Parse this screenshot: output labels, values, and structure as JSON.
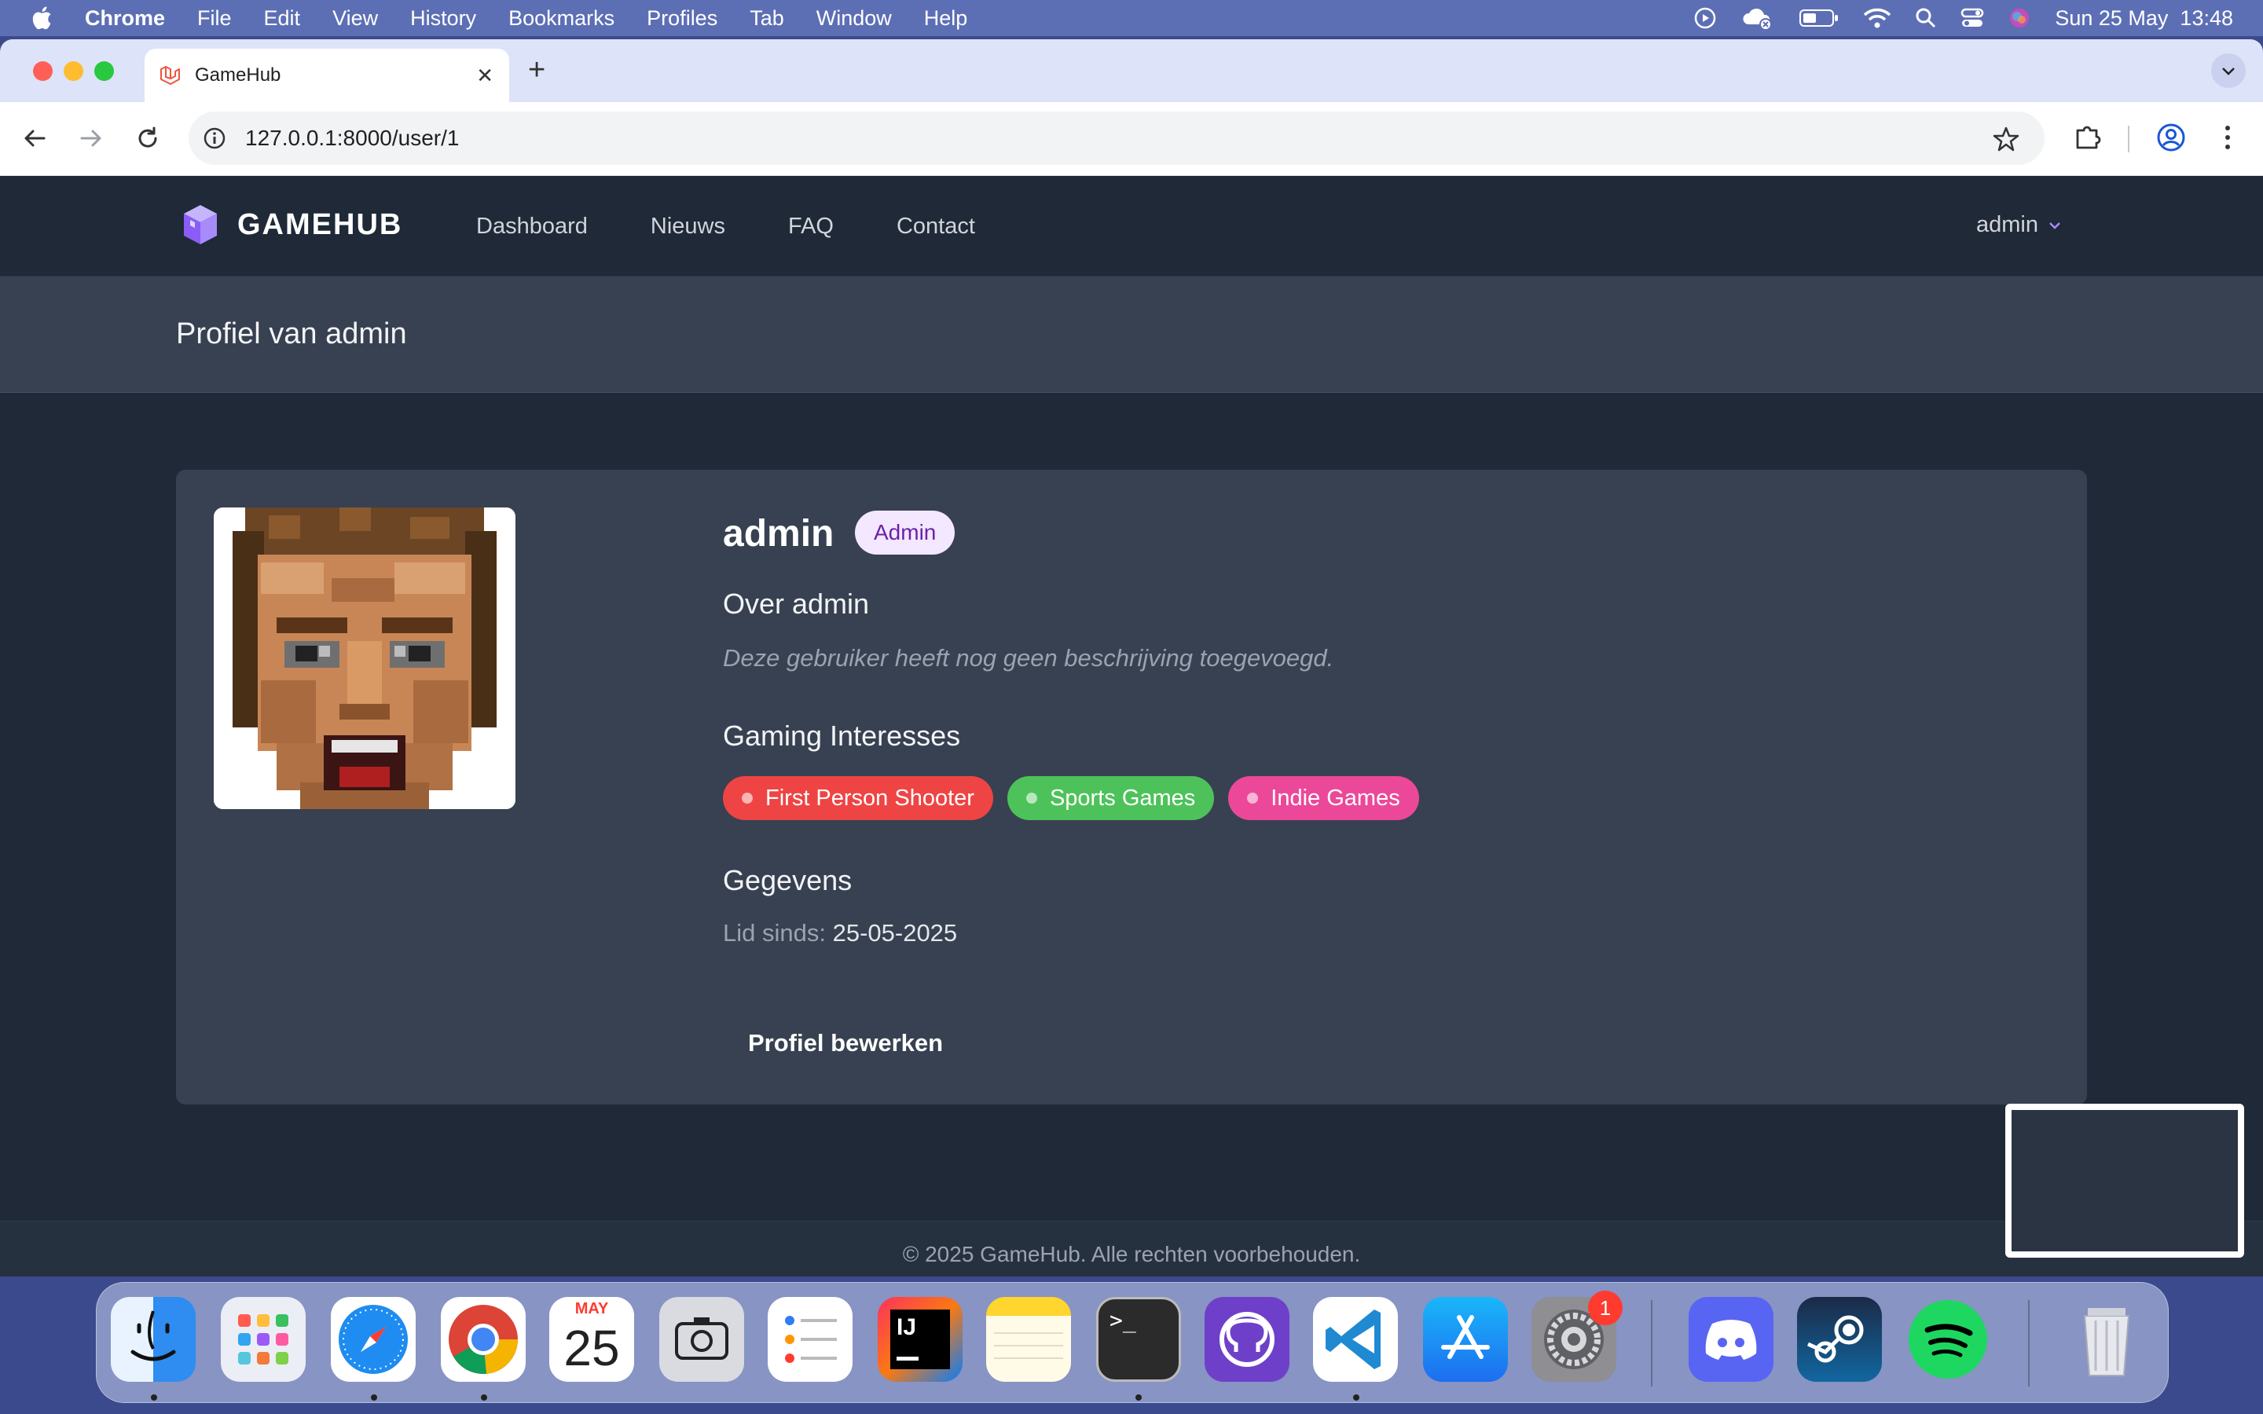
{
  "menubar": {
    "app_name": "Chrome",
    "items": [
      "File",
      "Edit",
      "View",
      "History",
      "Bookmarks",
      "Profiles",
      "Tab",
      "Window",
      "Help"
    ],
    "clock": "Sun 25 May  13:48"
  },
  "browser": {
    "tab_title": "GameHub",
    "url": "127.0.0.1:8000/user/1"
  },
  "site": {
    "brand": "GAMEHUB",
    "nav": [
      "Dashboard",
      "Nieuws",
      "FAQ",
      "Contact"
    ],
    "user_menu": "admin",
    "page_title": "Profiel van admin"
  },
  "profile": {
    "username": "admin",
    "role": "Admin",
    "about_title": "Over admin",
    "bio": "Deze gebruiker heeft nog geen beschrijving toegevoegd.",
    "interests_title": "Gaming Interesses",
    "interests": [
      {
        "label": "First Person Shooter",
        "color": "#ef4444"
      },
      {
        "label": "Sports Games",
        "color": "#4ec25a"
      },
      {
        "label": "Indie Games",
        "color": "#ec4899"
      }
    ],
    "details_title": "Gegevens",
    "member_since_label": "Lid sinds:",
    "member_since": "25-05-2025",
    "edit_button": "Profiel bewerken"
  },
  "footer": {
    "copyright": "© 2025 GameHub. Alle rechten voorbehouden."
  },
  "dock": {
    "calendar_month": "MAY",
    "calendar_day": "25",
    "settings_badge": "1"
  },
  "colors": {
    "page_bg": "#1f2937",
    "card_bg": "#374151",
    "accent": "#8b5cf6"
  }
}
